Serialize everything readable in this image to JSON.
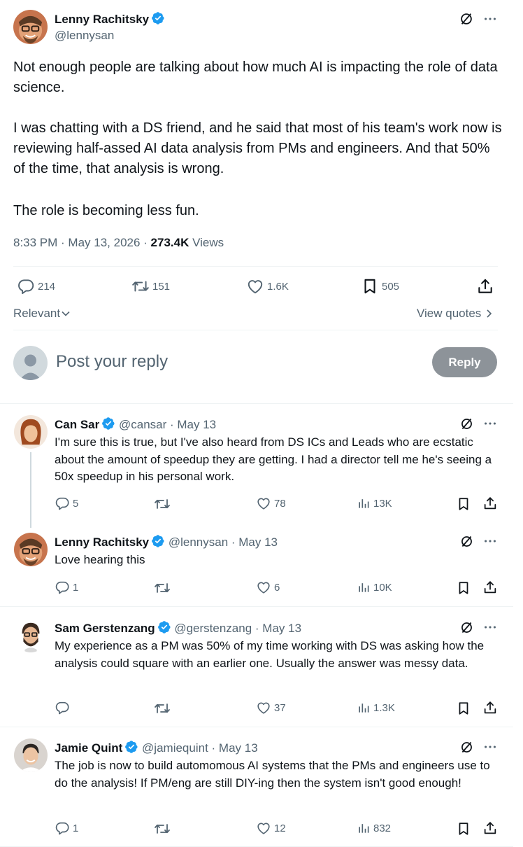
{
  "post": {
    "author_name": "Lenny Rachitsky",
    "author_handle": "@lennysan",
    "text_p1": "Not enough people are talking about how much AI is impacting the role of data science.",
    "text_p2": "I was chatting with a DS friend, and he said that most of his team's work now is reviewing half-assed AI data analysis from PMs and engineers. And that 50% of the time, that analysis is wrong.",
    "text_p3": "The role is becoming less fun.",
    "time": "8:33 PM · May 13, 2026 · ",
    "views_count": "273.4K",
    "views_label": " Views",
    "stats": {
      "replies": "214",
      "reposts": "151",
      "likes": "1.6K",
      "bookmarks": "505"
    }
  },
  "sort": {
    "label": "Relevant",
    "view_quotes": "View quotes"
  },
  "composer": {
    "placeholder": "Post your reply",
    "reply_button": "Reply"
  },
  "replies": [
    {
      "name": "Can Sar",
      "handle": "@cansar",
      "date": " · May 13",
      "text": "I'm sure this is true, but I've also heard from DS ICs and Leads who are ecstatic about the amount of speedup they are getting. I had a director tell me he's seeing a 50x speedup in his personal work.",
      "replies": "5",
      "reposts": "",
      "likes": "78",
      "views": "13K"
    },
    {
      "name": "Lenny Rachitsky",
      "handle": "@lennysan",
      "date": " · May 13",
      "text": "Love hearing this",
      "replies": "1",
      "reposts": "",
      "likes": "6",
      "views": "10K"
    },
    {
      "name": "Sam Gerstenzang",
      "handle": "@gerstenzang",
      "date": " · May 13",
      "text": "My experience as a PM was 50% of my time working with DS was asking how the analysis could square with an earlier one. Usually the answer was messy data.",
      "replies": "",
      "reposts": "",
      "likes": "37",
      "views": "1.3K"
    },
    {
      "name": "Jamie Quint",
      "handle": "@jamiequint",
      "date": " · May 13",
      "text": "The job is now to build automomous AI systems that the PMs and engineers use to do the analysis! If PM/eng are still DIY-ing then the system isn't good enough!",
      "replies": "1",
      "reposts": "",
      "likes": "12",
      "views": "832"
    }
  ],
  "colors": {
    "verified": "#1d9bf0",
    "muted": "#536471",
    "reply_button_bg": "#8d9399"
  }
}
